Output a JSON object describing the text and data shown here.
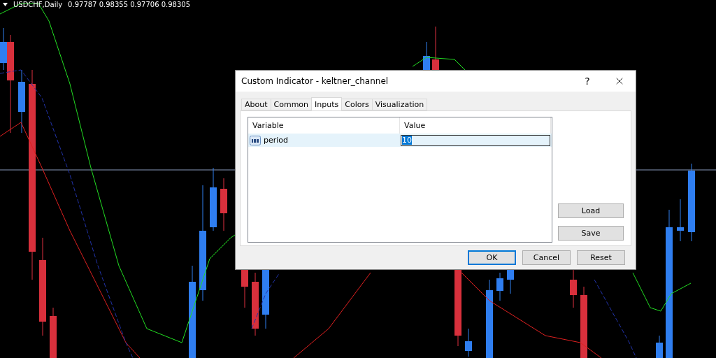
{
  "chart": {
    "symbol": "USDCHF,Daily",
    "prices": "0.97787 0.98355 0.97706 0.98305"
  },
  "dialog": {
    "title": "Custom Indicator - keltner_channel",
    "help": "?",
    "tabs": [
      {
        "label": "About",
        "selected": false
      },
      {
        "label": "Common",
        "selected": false
      },
      {
        "label": "Inputs",
        "selected": true
      },
      {
        "label": "Colors",
        "selected": false
      },
      {
        "label": "Visualization",
        "selected": false
      }
    ],
    "table": {
      "columns": [
        "Variable",
        "Value"
      ],
      "rows": [
        {
          "variable": "period",
          "value": "10",
          "selected": true
        }
      ]
    },
    "side_buttons": [
      "Load",
      "Save"
    ],
    "buttons": [
      {
        "label": "OK",
        "default": true
      },
      {
        "label": "Cancel",
        "default": false
      },
      {
        "label": "Reset",
        "default": false
      }
    ]
  }
}
